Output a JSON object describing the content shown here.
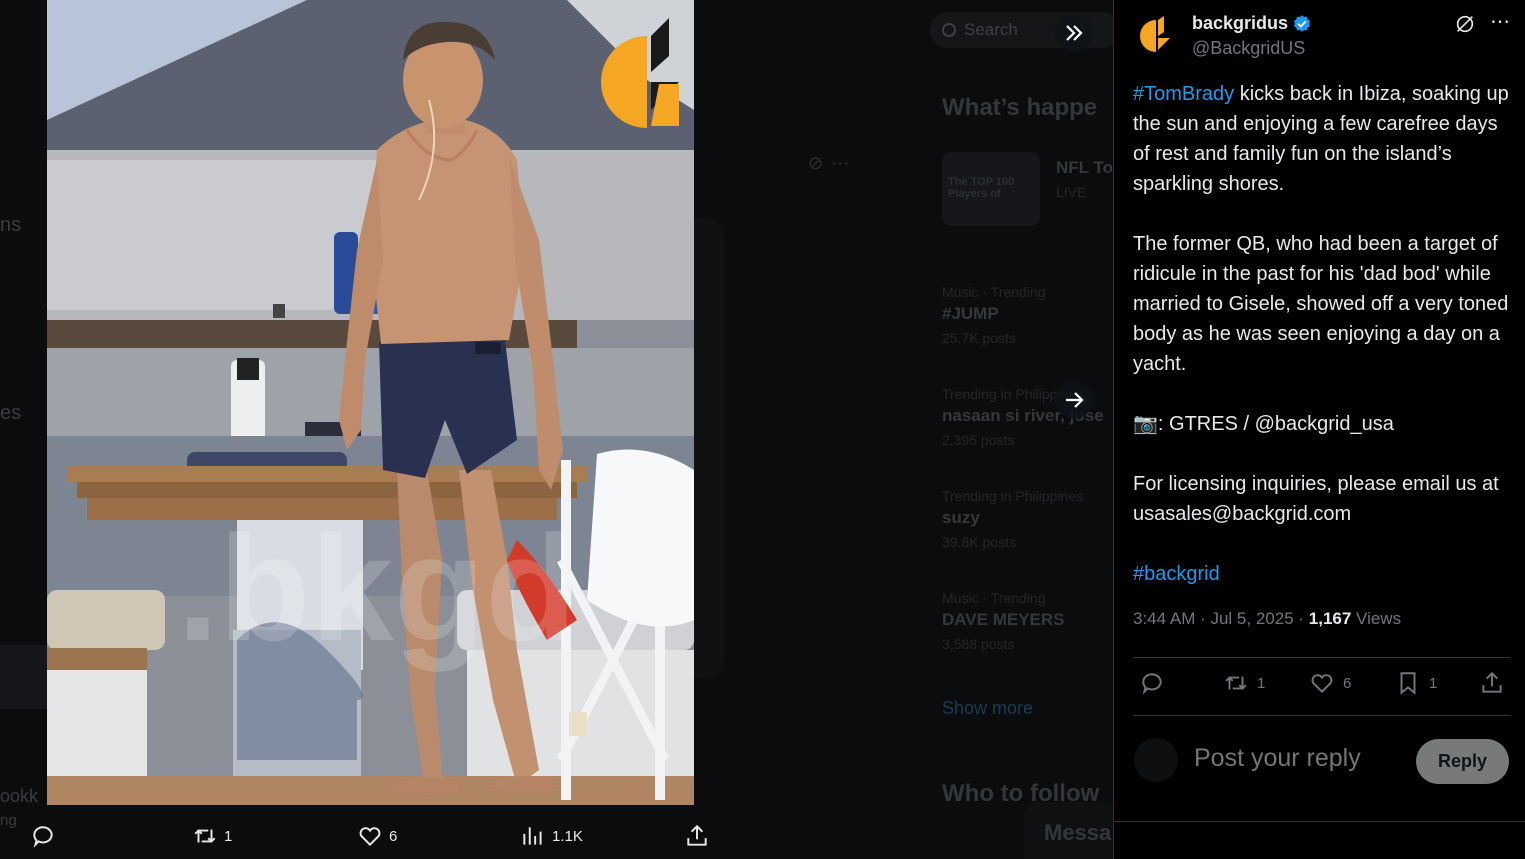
{
  "background": {
    "left_fragments": [
      "ns",
      "es",
      "ookk",
      "ng"
    ],
    "search_placeholder": "Search",
    "whats_happening": "What’s happe",
    "nfl_title": "NFL To",
    "nfl_badge": "LIVE",
    "nfl_image_text": "The TOP 100 Players of",
    "trends": [
      {
        "context": "Music · Trending",
        "title": "#JUMP",
        "count": "25.7K posts"
      },
      {
        "context": "Trending in Philippines",
        "title": "nasaan si river, jose",
        "count": "2,395 posts"
      },
      {
        "context": "Trending in Philippines",
        "title": "suzy",
        "count": "39.8K posts"
      },
      {
        "context": "Music · Trending",
        "title": "DAVE MEYERS",
        "count": "3,588 posts"
      }
    ],
    "show_more": "Show more",
    "who_to_follow": "Who to follow",
    "messages": "Messa"
  },
  "photo": {
    "watermark": ".bkgd",
    "logo_colors": {
      "orange": "#f5a623",
      "dark": "#1a1a1a"
    }
  },
  "media_controls": {
    "expand_icon": "double-chevron-right-icon",
    "next_icon": "arrow-right-icon"
  },
  "media_actions": {
    "reply_count": "",
    "retweet_count": "1",
    "like_count": "6",
    "views_count": "1.1K"
  },
  "tweet": {
    "author_name": "backgridus",
    "author_handle": "@BackgridUS",
    "text_parts": {
      "hashtag1": "#TomBrady",
      "para1_rest": " kicks back in Ibiza, soaking up the sun and enjoying a few carefree days of rest and family fun on the island’s sparkling shores.",
      "para2": "The former QB, who had been a target of ridicule in the past for his 'dad bod' while married to Gisele, showed off a very toned body as he was seen enjoying a day on a yacht.",
      "para3": "📷: GTRES / @backgrid_usa",
      "para4": "For licensing inquiries, please email us at usasales@backgrid.com",
      "hashtag2": "#backgrid"
    },
    "timestamp": "3:44 AM · Jul 5, 2025 · ",
    "views_count": "1,167",
    "views_label": " Views",
    "retweet_count": "1",
    "like_count": "6",
    "bookmark_count": "1"
  },
  "reply": {
    "placeholder": "Post your reply",
    "button_label": "Reply"
  },
  "colors": {
    "accent": "#1d9bf0",
    "text": "#e7e9ea",
    "secondary": "#71767b",
    "border": "#2f3336"
  }
}
